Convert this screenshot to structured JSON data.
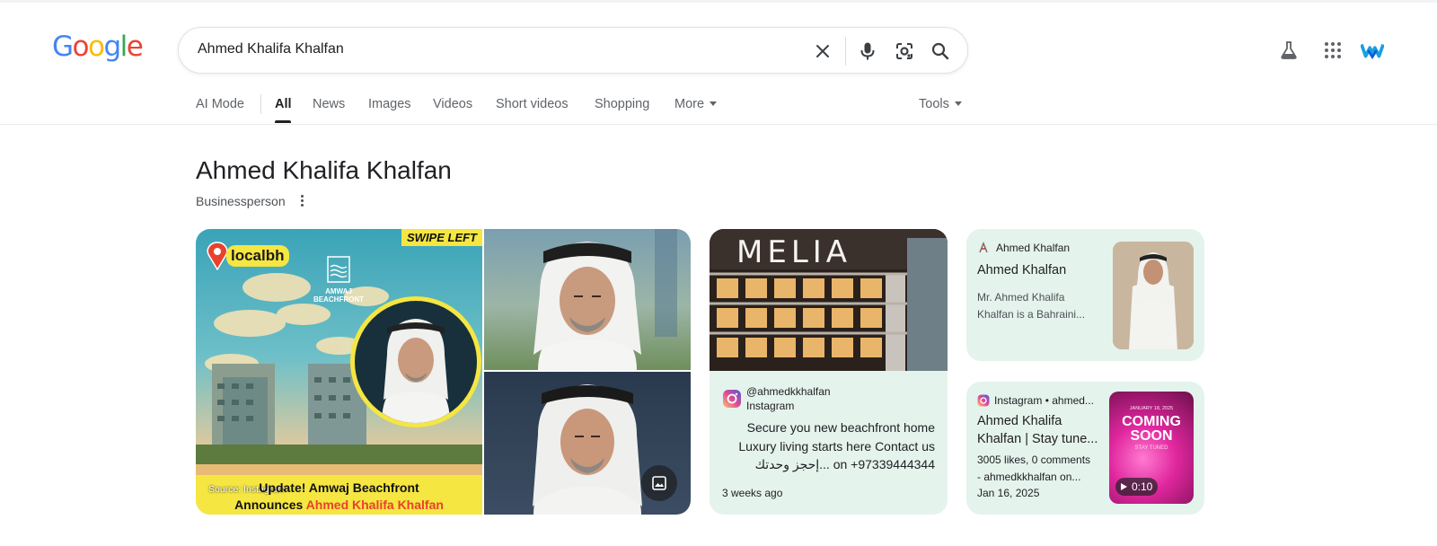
{
  "search": {
    "query": "Ahmed Khalifa Khalfan"
  },
  "logo": {
    "letters": [
      "G",
      "o",
      "o",
      "g",
      "l",
      "e"
    ],
    "colors": [
      "#4285F4",
      "#EA4335",
      "#FBBC05",
      "#4285F4",
      "#34A853",
      "#EA4335"
    ]
  },
  "tabs": [
    {
      "label": "AI Mode"
    },
    {
      "label": "All"
    },
    {
      "label": "News"
    },
    {
      "label": "Images"
    },
    {
      "label": "Videos"
    },
    {
      "label": "Short videos"
    },
    {
      "label": "Shopping"
    },
    {
      "label": "More"
    }
  ],
  "tools_label": "Tools",
  "entity": {
    "title": "Ahmed Khalifa Khalfan",
    "subtitle": "Businessperson"
  },
  "collage": {
    "badge": "SWIPE LEFT",
    "brand": "localbh",
    "project": "AMWAJ\nBEACHFRONT",
    "source": "Source: Instagram",
    "headline_1": "Update! Amwaj Beachfront",
    "headline_2": "Announces ",
    "headline_highlight": "Ahmed Khalifa Khalfan"
  },
  "ig_card": {
    "image_text": "MELIA",
    "handle": "@ahmedkkhalfan",
    "platform": "Instagram",
    "caption_1": "Secure you new beachfront home",
    "caption_2": "Luxury living starts here Contact us",
    "caption_3": "إحجز وحدتك... on +97339444344",
    "time": "3 weeks ago"
  },
  "card1": {
    "source": "Ahmed Khalfan",
    "title": "Ahmed Khalfan",
    "snippet_1": "Mr. Ahmed Khalifa",
    "snippet_2": "Khalfan is a Bahraini..."
  },
  "card2": {
    "source": "Instagram • ahmed...",
    "title_1": "Ahmed Khalifa",
    "title_2": "Khalfan | Stay tune...",
    "meta_1": "3005 likes, 0 comments",
    "meta_2": "- ahmedkkhalfan on...",
    "date": "Jan 16, 2025",
    "thumb_top": "JANUARY 18, 2025",
    "thumb_title_1": "COMING",
    "thumb_title_2": "SOON",
    "thumb_sub": "STAY TUNED",
    "duration": "0:10"
  }
}
